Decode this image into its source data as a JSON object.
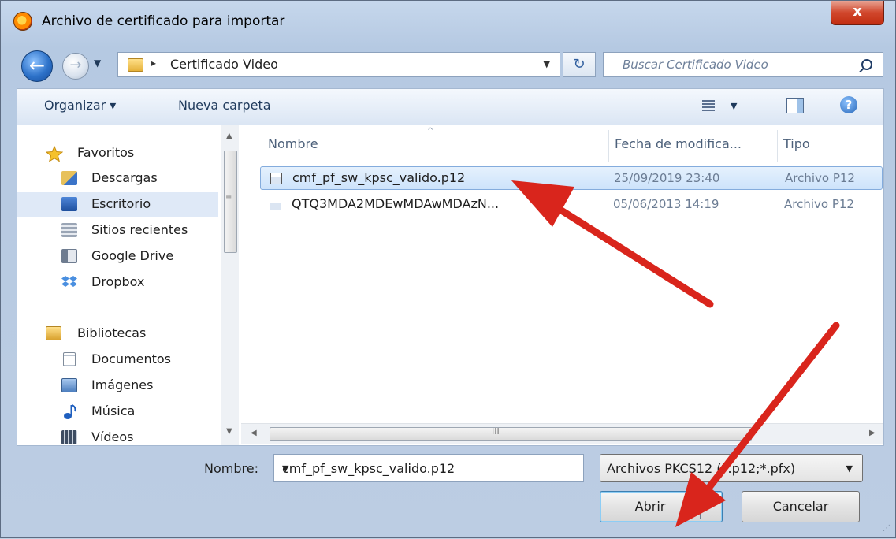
{
  "window": {
    "title": "Archivo de certificado para importar",
    "close_glyph": "x"
  },
  "nav": {
    "back_glyph": "←",
    "forward_glyph": "→",
    "history_glyph": "▼",
    "path_arrow": "▸",
    "path": "Certificado Video",
    "path_dropdown": "▼",
    "refresh_glyph": "↻",
    "search_placeholder": "Buscar Certificado Video"
  },
  "toolbar": {
    "organize_label": "Organizar ▾",
    "new_folder_label": "Nueva carpeta",
    "view_dropdown": "▼",
    "help_glyph": "?"
  },
  "sidebar": {
    "items": [
      {
        "label": "Favoritos",
        "icon": "star-icon",
        "color": "#f5c12c"
      },
      {
        "label": "Descargas",
        "icon": "downloads-icon",
        "color": "#3b74c8"
      },
      {
        "label": "Escritorio",
        "icon": "desktop-icon",
        "color": "#2a5fb3"
      },
      {
        "label": "Sitios recientes",
        "icon": "recent-places-icon",
        "color": "#9aa5b5"
      },
      {
        "label": "Google Drive",
        "icon": "google-drive-icon",
        "color": "#8c99ab"
      },
      {
        "label": "Dropbox",
        "icon": "dropbox-icon",
        "color": "#4a8fe0"
      },
      {
        "label": "Bibliotecas",
        "icon": "libraries-icon",
        "color": "#e2b443"
      },
      {
        "label": "Documentos",
        "icon": "documents-icon",
        "color": "#c9d2dd"
      },
      {
        "label": "Imágenes",
        "icon": "pictures-icon",
        "color": "#6f9dd0"
      },
      {
        "label": "Música",
        "icon": "music-icon",
        "color": "#1f5fbf"
      },
      {
        "label": "Vídeos",
        "icon": "videos-icon",
        "color": "#3d4c62"
      }
    ],
    "selected": "Escritorio"
  },
  "file_list": {
    "columns": [
      "Nombre",
      "Fecha de modifica...",
      "Tipo"
    ],
    "sort_glyph": "^",
    "rows": [
      {
        "name": "cmf_pf_sw_kpsc_valido.p12",
        "date": "25/09/2019 23:40",
        "type": "Archivo P12",
        "selected": true
      },
      {
        "name": "QTQ3MDA2MDEwMDAwMDAzN...",
        "date": "05/06/2013 14:19",
        "type": "Archivo P12",
        "selected": false
      }
    ]
  },
  "footer": {
    "filename_label": "Nombre:",
    "filename_value": "cmf_pf_sw_kpsc_valido.p12",
    "dropdown_glyph": "▼",
    "filter_value": "Archivos PKCS12 (*.p12;*.pfx)",
    "open_label": "Abrir",
    "cancel_label": "Cancelar"
  },
  "annotation_color": "#d9251c"
}
